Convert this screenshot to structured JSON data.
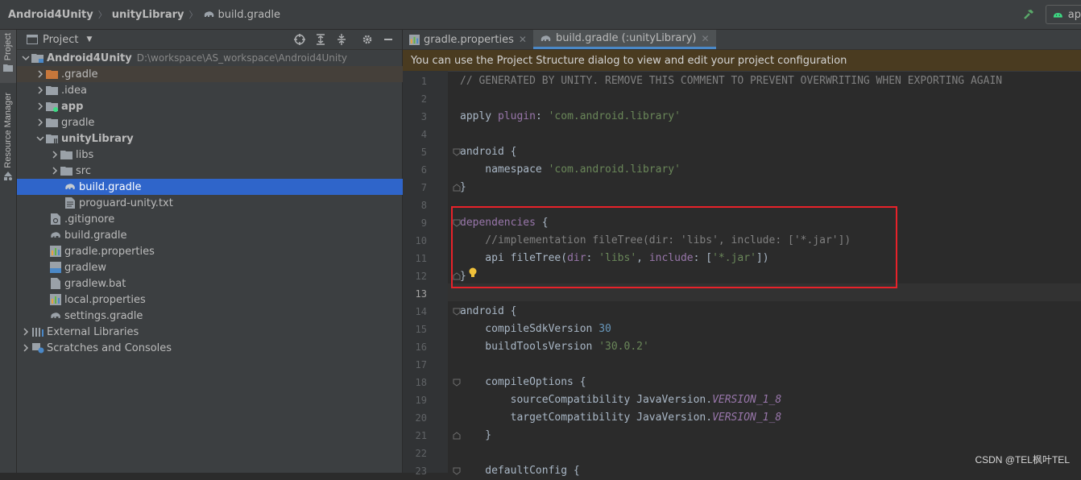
{
  "breadcrumb": {
    "items": [
      "Android4Unity",
      "unityLibrary",
      "build.gradle"
    ]
  },
  "toolbar": {
    "run_config": "ap"
  },
  "side_tabs": {
    "project": "Project",
    "resource_manager": "Resource Manager"
  },
  "project_panel": {
    "title": "Project",
    "tree": [
      {
        "label": "Android4Unity",
        "path": "D:\\workspace\\AS_workspace\\Android4Unity",
        "icon": "module-folder-icon",
        "bold": true,
        "expanded": true
      },
      {
        "label": ".gradle",
        "icon": "folder-orange-icon",
        "expanded": false
      },
      {
        "label": ".idea",
        "icon": "folder-icon",
        "expanded": false
      },
      {
        "label": "app",
        "icon": "android-module-icon",
        "bold": true,
        "expanded": false
      },
      {
        "label": "gradle",
        "icon": "folder-icon",
        "expanded": false
      },
      {
        "label": "unityLibrary",
        "icon": "library-module-icon",
        "bold": true,
        "expanded": true
      },
      {
        "label": "libs",
        "icon": "folder-icon",
        "expanded": false
      },
      {
        "label": "src",
        "icon": "folder-icon",
        "expanded": false
      },
      {
        "label": "build.gradle",
        "icon": "gradle-elephant-icon",
        "selected": true
      },
      {
        "label": "proguard-unity.txt",
        "icon": "text-file-icon"
      },
      {
        "label": ".gitignore",
        "icon": "gitignore-icon"
      },
      {
        "label": "build.gradle",
        "icon": "gradle-elephant-icon"
      },
      {
        "label": "gradle.properties",
        "icon": "properties-icon"
      },
      {
        "label": "gradlew",
        "icon": "shell-script-icon"
      },
      {
        "label": "gradlew.bat",
        "icon": "bat-file-icon"
      },
      {
        "label": "local.properties",
        "icon": "properties-icon"
      },
      {
        "label": "settings.gradle",
        "icon": "gradle-elephant-icon"
      },
      {
        "label": "External Libraries",
        "icon": "library-bars-icon",
        "expanded": false
      },
      {
        "label": "Scratches and Consoles",
        "icon": "scratches-icon",
        "expanded": false
      }
    ]
  },
  "editor": {
    "tabs": [
      {
        "label": "gradle.properties",
        "active": false
      },
      {
        "label": "build.gradle (:unityLibrary)",
        "active": true
      }
    ],
    "notice": "You can use the Project Structure dialog to view and edit your project configuration",
    "line_numbers": [
      "1",
      "2",
      "3",
      "4",
      "5",
      "6",
      "7",
      "8",
      "9",
      "10",
      "11",
      "12",
      "13",
      "14",
      "15",
      "16",
      "17",
      "18",
      "19",
      "20",
      "21",
      "22",
      "23"
    ],
    "current_line": "13",
    "code": {
      "l1": "// GENERATED BY UNITY. REMOVE THIS COMMENT TO PREVENT OVERWRITING WHEN EXPORTING AGAIN",
      "l3_a": "apply ",
      "l3_b": "plugin",
      "l3_c": ": ",
      "l3_d": "'com.android.library'",
      "l5": "android {",
      "l6_a": "    namespace ",
      "l6_b": "'com.android.library'",
      "l7": "}",
      "l9_a": "dependencies",
      "l9_b": " {",
      "l10": "    //implementation fileTree(dir: 'libs', include: ['*.jar'])",
      "l11_a": "    api fileTree(",
      "l11_b": "dir",
      "l11_c": ": ",
      "l11_d": "'libs'",
      "l11_e": ", ",
      "l11_f": "include",
      "l11_g": ": [",
      "l11_h": "'*.jar'",
      "l11_i": "])",
      "l12": "}",
      "l14": "android {",
      "l15_a": "    compileSdkVersion ",
      "l15_b": "30",
      "l16_a": "    buildToolsVersion ",
      "l16_b": "'30.0.2'",
      "l18": "    compileOptions {",
      "l19_a": "        sourceCompatibility JavaVersion.",
      "l19_b": "VERSION_1_8",
      "l20_a": "        targetCompatibility JavaVersion.",
      "l20_b": "VERSION_1_8",
      "l21": "    }",
      "l23": "    defaultConfig {"
    }
  },
  "watermark": "CSDN @TEL枫叶TEL",
  "colors": {
    "selection": "#2f65ca",
    "highlight_box": "#e8222a",
    "notice_bg": "#4a3b20"
  }
}
